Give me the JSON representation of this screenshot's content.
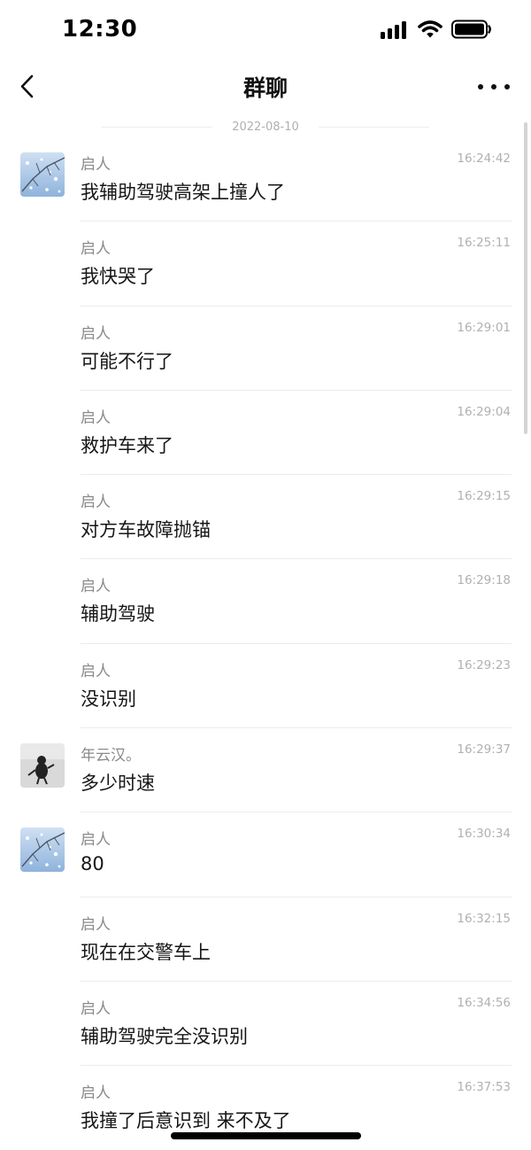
{
  "status": {
    "time": "12:30"
  },
  "header": {
    "title": "群聊"
  },
  "date_divider": "2022-08-10",
  "messages": [
    {
      "sender": "启人",
      "time": "16:24:42",
      "text": "我辅助驾驶高架上撞人了",
      "avatar": "snow-branch"
    },
    {
      "sender": "启人",
      "time": "16:25:11",
      "text": "我快哭了",
      "avatar": ""
    },
    {
      "sender": "启人",
      "time": "16:29:01",
      "text": "可能不行了",
      "avatar": ""
    },
    {
      "sender": "启人",
      "time": "16:29:04",
      "text": "救护车来了",
      "avatar": ""
    },
    {
      "sender": "启人",
      "time": "16:29:15",
      "text": "对方车故障抛锚",
      "avatar": ""
    },
    {
      "sender": "启人",
      "time": "16:29:18",
      "text": "辅助驾驶",
      "avatar": ""
    },
    {
      "sender": "启人",
      "time": "16:29:23",
      "text": "没识别",
      "avatar": ""
    },
    {
      "sender": "年云汉。",
      "time": "16:29:37",
      "text": "多少时速",
      "avatar": "dark-figure"
    },
    {
      "sender": "启人",
      "time": "16:30:34",
      "text": "80",
      "avatar": "snow-branch"
    },
    {
      "sender": "启人",
      "time": "16:32:15",
      "text": "现在在交警车上",
      "avatar": ""
    },
    {
      "sender": "启人",
      "time": "16:34:56",
      "text": "辅助驾驶完全没识别",
      "avatar": ""
    },
    {
      "sender": "启人",
      "time": "16:37:53",
      "text": "我撞了后意识到 来不及了",
      "avatar": ""
    }
  ]
}
